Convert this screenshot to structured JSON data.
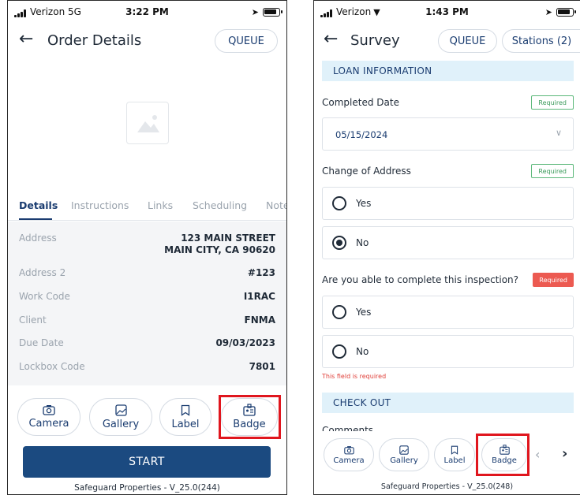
{
  "left": {
    "status": {
      "carrier": "Verizon 5G",
      "time": "3:22 PM"
    },
    "header": {
      "title": "Order Details",
      "queue": "QUEUE"
    },
    "tabs": [
      "Details",
      "Instructions",
      "Links",
      "Scheduling",
      "Note"
    ],
    "details": [
      {
        "label": "Address",
        "value": "123 MAIN STREET\nMAIN CITY, CA 90620"
      },
      {
        "label": "Address 2",
        "value": "#123"
      },
      {
        "label": "Work Code",
        "value": "I1RAC"
      },
      {
        "label": "Client",
        "value": "FNMA"
      },
      {
        "label": "Due Date",
        "value": "09/03/2023"
      },
      {
        "label": "Lockbox Code",
        "value": "7801"
      }
    ],
    "actions": {
      "camera": "Camera",
      "gallery": "Gallery",
      "label": "Label",
      "badge": "Badge"
    },
    "start": "START",
    "footer": "Safeguard Properties - V_25.0(244)"
  },
  "right": {
    "status": {
      "carrier": "Verizon",
      "time": "1:43 PM"
    },
    "header": {
      "title": "Survey",
      "queue": "QUEUE",
      "stations": "Stations (2)"
    },
    "section1": "LOAN INFORMATION",
    "q1": {
      "label": "Completed Date",
      "badge": "Required",
      "value": "05/15/2024"
    },
    "q2": {
      "label": "Change of Address",
      "badge": "Required",
      "yes": "Yes",
      "no": "No"
    },
    "q3": {
      "label": "Are you able to complete this inspection?",
      "badge": "Required",
      "yes": "Yes",
      "no": "No",
      "error": "This field is required"
    },
    "section2": "CHECK OUT",
    "comments_partial": "Comments",
    "actions": {
      "camera": "Camera",
      "gallery": "Gallery",
      "label": "Label",
      "badge": "Badge"
    },
    "footer": "Safeguard Properties - V_25.0(248)"
  },
  "colors": {
    "primary": "#1b4a80",
    "highlight": "#e0161e",
    "required_red": "#ec5a51",
    "required_green": "#3a9a5a",
    "section_bg": "#e0f1fa"
  }
}
